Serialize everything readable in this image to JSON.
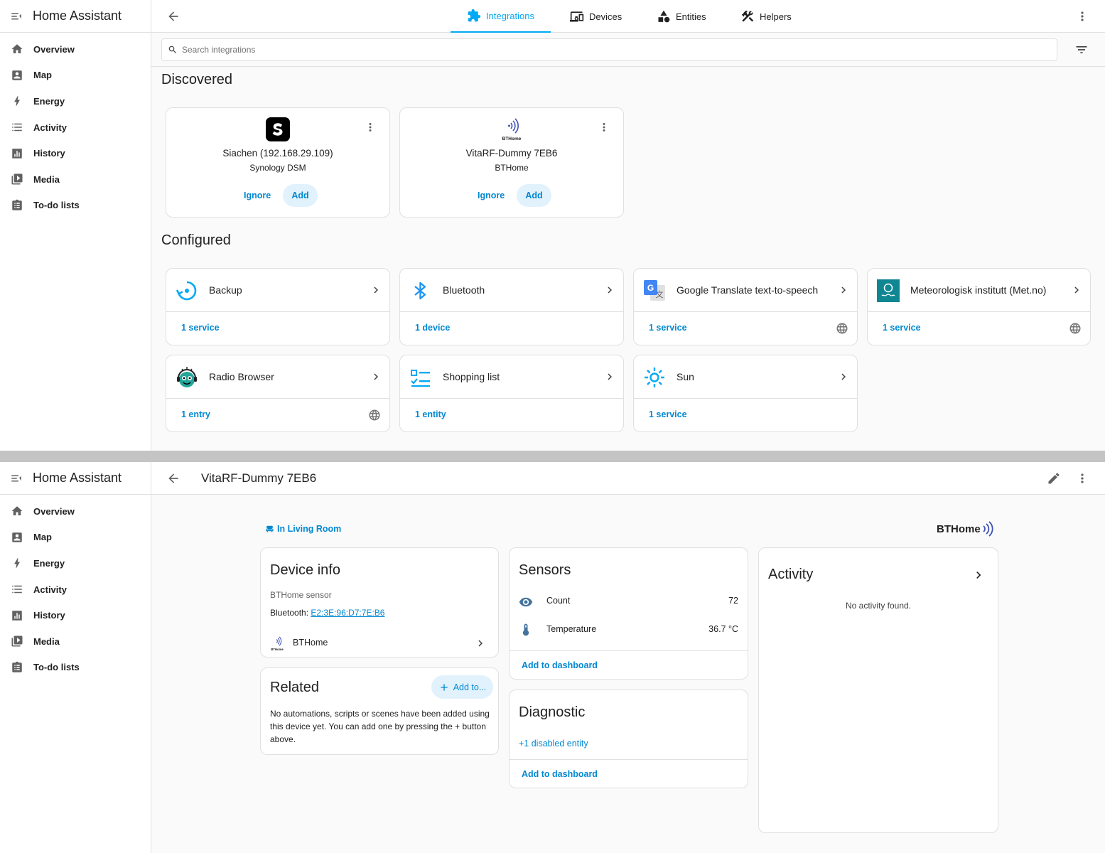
{
  "app": {
    "title": "Home Assistant"
  },
  "sidebar": {
    "items": [
      {
        "label": "Overview",
        "icon": "home-icon"
      },
      {
        "label": "Map",
        "icon": "map-icon"
      },
      {
        "label": "Energy",
        "icon": "lightning-icon"
      },
      {
        "label": "Activity",
        "icon": "list-icon"
      },
      {
        "label": "History",
        "icon": "chart-icon"
      },
      {
        "label": "Media",
        "icon": "media-icon"
      },
      {
        "label": "To-do lists",
        "icon": "clipboard-icon"
      }
    ]
  },
  "integrations_page": {
    "tabs": [
      {
        "label": "Integrations",
        "icon": "puzzle-icon",
        "active": true
      },
      {
        "label": "Devices",
        "icon": "devices-icon",
        "active": false
      },
      {
        "label": "Entities",
        "icon": "shapes-icon",
        "active": false
      },
      {
        "label": "Helpers",
        "icon": "tools-icon",
        "active": false
      }
    ],
    "search_placeholder": "Search integrations",
    "discovered_title": "Discovered",
    "configured_title": "Configured",
    "discovered": [
      {
        "name": "Siachen (192.168.29.109)",
        "subtitle": "Synology DSM",
        "ignore": "Ignore",
        "add": "Add",
        "logo": "synology-s-icon"
      },
      {
        "name": "VitaRF-Dummy 7EB6",
        "subtitle": "BTHome",
        "ignore": "Ignore",
        "add": "Add",
        "logo": "bthome-icon",
        "logo_text": "BTHome"
      }
    ],
    "configured": [
      {
        "name": "Backup",
        "link": "1 service",
        "icon": "backup-icon",
        "cloud": false
      },
      {
        "name": "Bluetooth",
        "link": "1 device",
        "icon": "bluetooth-icon",
        "cloud": false
      },
      {
        "name": "Google Translate text-to-speech",
        "link": "1 service",
        "icon": "google-translate-icon",
        "cloud": true
      },
      {
        "name": "Meteorologisk institutt (Met.no)",
        "link": "1 service",
        "icon": "met-no-icon",
        "cloud": true
      },
      {
        "name": "Radio Browser",
        "link": "1 entry",
        "icon": "radio-browser-icon",
        "cloud": true
      },
      {
        "name": "Shopping list",
        "link": "1 entity",
        "icon": "shopping-list-icon",
        "cloud": false
      },
      {
        "name": "Sun",
        "link": "1 service",
        "icon": "sun-icon",
        "cloud": false
      }
    ]
  },
  "device_page": {
    "title": "VitaRF-Dummy 7EB6",
    "area": "In Living Room",
    "brand": "BTHome",
    "device_info": {
      "title": "Device info",
      "model": "BTHome sensor",
      "connection_label": "Bluetooth:",
      "mac": "E2:3E:96:D7:7E:B6",
      "integration": "BTHome",
      "integration_logo_text": "BTHome"
    },
    "related": {
      "title": "Related",
      "add_button": "Add to...",
      "text": "No automations, scripts or scenes have been added using this device yet. You can add one by pressing the + button above."
    },
    "sensors": {
      "title": "Sensors",
      "rows": [
        {
          "name": "Count",
          "value": "72",
          "icon": "eye-icon"
        },
        {
          "name": "Temperature",
          "value": "36.7 °C",
          "icon": "thermometer-icon"
        }
      ],
      "add_to_dashboard": "Add to dashboard"
    },
    "diagnostic": {
      "title": "Diagnostic",
      "disabled": "+1 disabled entity",
      "add_to_dashboard": "Add to dashboard"
    },
    "activity": {
      "title": "Activity",
      "empty": "No activity found."
    }
  },
  "colors": {
    "accent": "#03a9f4",
    "link": "#0288d1",
    "chip": "#e1f2fc"
  }
}
